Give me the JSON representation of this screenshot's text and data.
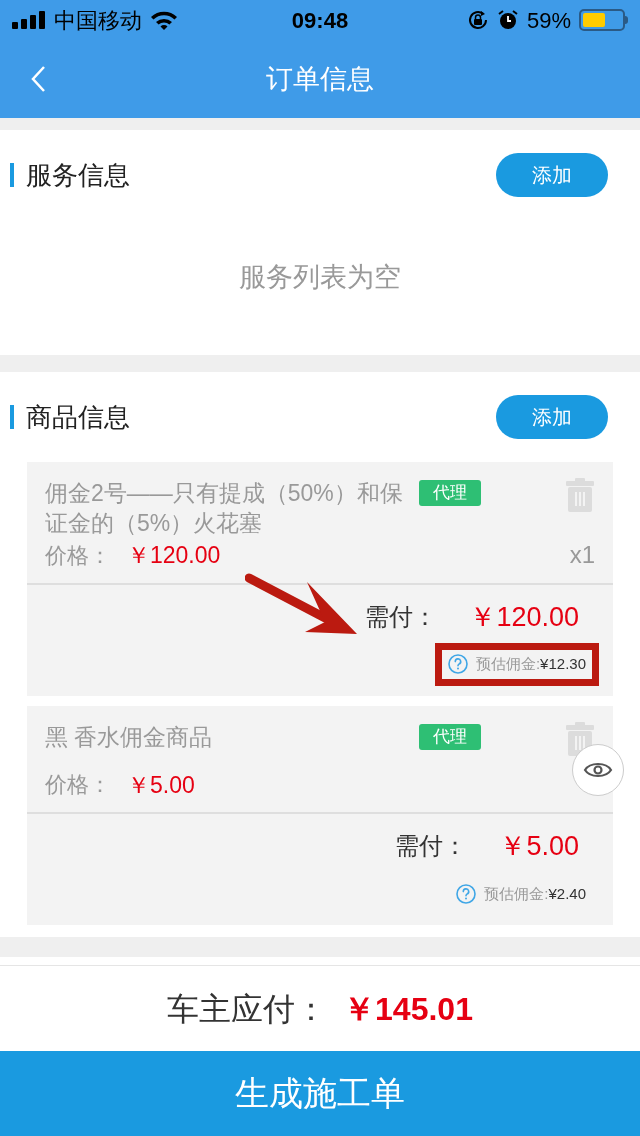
{
  "status_bar": {
    "carrier": "中国移动",
    "time": "09:48",
    "battery": "59%"
  },
  "nav": {
    "title": "订单信息"
  },
  "service_section": {
    "title": "服务信息",
    "add_button": "添加",
    "empty_text": "服务列表为空"
  },
  "goods_section": {
    "title": "商品信息",
    "add_button": "添加",
    "items": [
      {
        "name": "佣金2号——只有提成（50%）和保证金的（5%）火花塞",
        "tag": "代理",
        "price_label": "价格：",
        "price": "￥120.00",
        "quantity": "x1",
        "due_label": "需付：",
        "due": "￥120.00",
        "commission_label": "预估佣金:",
        "commission_value": "¥12.30",
        "annotated": true
      },
      {
        "name": "黑 香水佣金商品",
        "tag": "代理",
        "price_label": "价格：",
        "price": "￥5.00",
        "due_label": "需付：",
        "due": "￥5.00",
        "commission_label": "预估佣金:",
        "commission_value": "¥2.40",
        "annotated": false
      }
    ]
  },
  "footer": {
    "total_label": "车主应付：",
    "total": "￥145.01",
    "submit_button": "生成施工单"
  }
}
